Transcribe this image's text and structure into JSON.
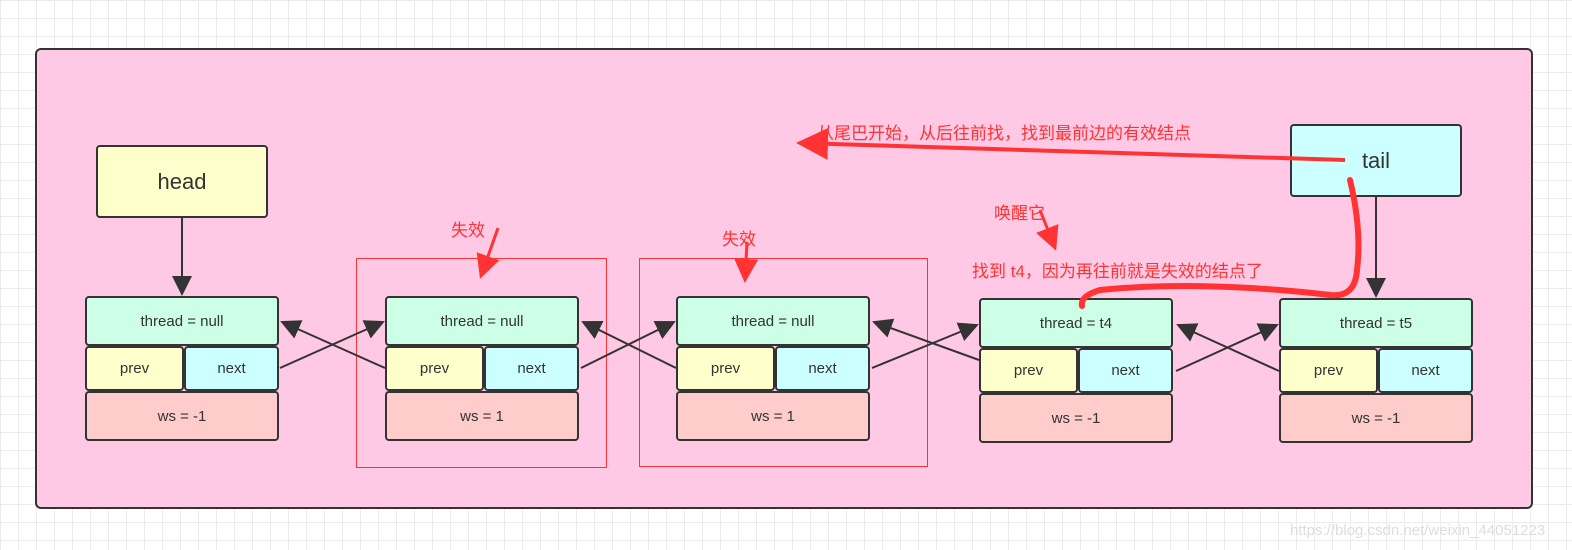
{
  "head_label": "head",
  "tail_label": "tail",
  "nodes": [
    {
      "thread": "thread = null",
      "prev": "prev",
      "next": "next",
      "ws": "ws = -1"
    },
    {
      "thread": "thread = null",
      "prev": "prev",
      "next": "next",
      "ws": "ws = 1"
    },
    {
      "thread": "thread = null",
      "prev": "prev",
      "next": "next",
      "ws": "ws = 1"
    },
    {
      "thread": "thread = t4",
      "prev": "prev",
      "next": "next",
      "ws": "ws = -1"
    },
    {
      "thread": "thread = t5",
      "prev": "prev",
      "next": "next",
      "ws": "ws = -1"
    }
  ],
  "annotations": {
    "scan": "从尾巴开始，从后往前找，找到最前边的有效结点",
    "invalid1": "失效",
    "invalid2": "失效",
    "wake": "唤醒它",
    "found": "找到 t4，因为再往前就是失效的结点了"
  },
  "watermark": "https://blog.csdn.net/weixin_44051223",
  "colors": {
    "frame": "#ffc8e4",
    "annotation": "#ff3333",
    "head": "#ffffcc",
    "tail": "#ccffff",
    "thread": "#ccffe6",
    "ws": "#ffcccc"
  }
}
